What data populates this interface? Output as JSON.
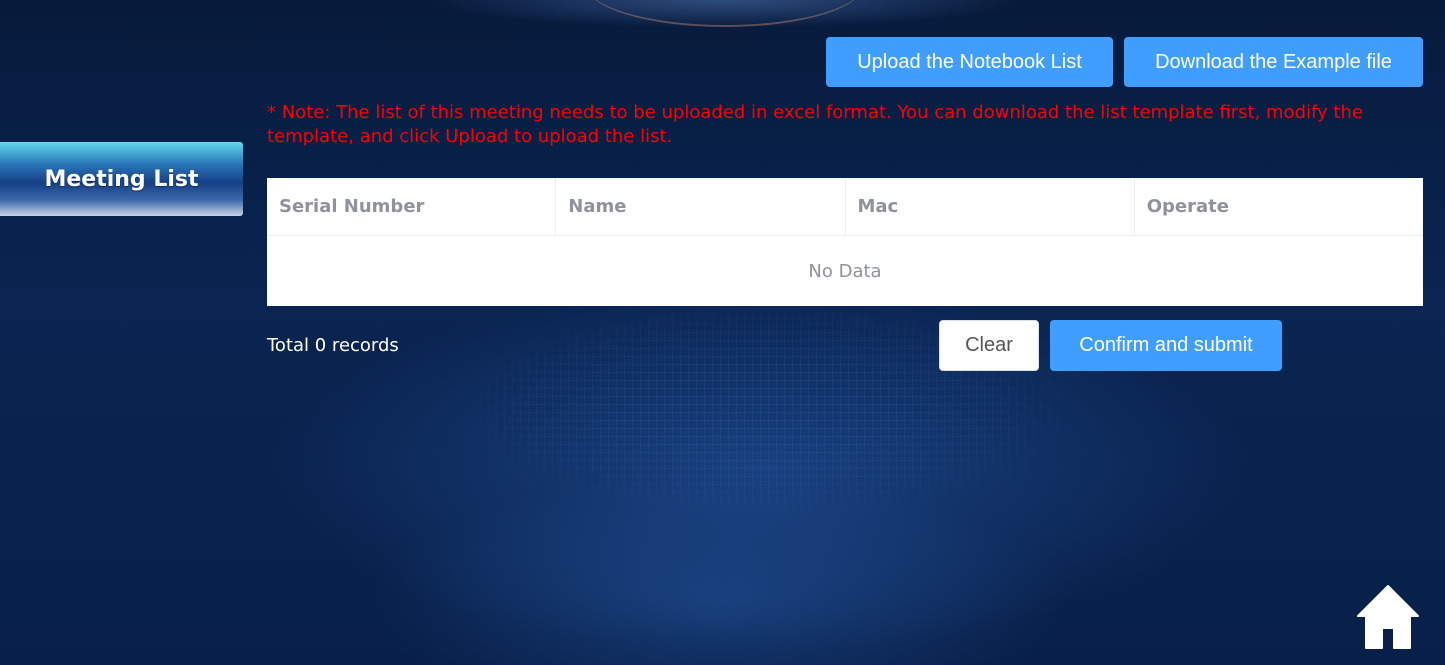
{
  "sidebar": {
    "active_tab_label": "Meeting List"
  },
  "toolbar": {
    "upload_label": "Upload the Notebook List",
    "download_label": "Download the Example file"
  },
  "note": {
    "text": "* Note: The list of this meeting needs to be uploaded in excel format. You can download the list template first, modify the template, and click Upload to upload the list."
  },
  "table": {
    "columns": [
      "Serial Number",
      "Name",
      "Mac",
      "Operate"
    ],
    "rows": [],
    "empty_text": "No Data"
  },
  "footer": {
    "total_text": "Total 0 records",
    "clear_label": "Clear",
    "confirm_label": "Confirm and submit"
  },
  "icons": {
    "home": "home-icon"
  },
  "colors": {
    "primary_button": "#409eff",
    "note_text": "#ff0000",
    "background": "#0a2552"
  }
}
